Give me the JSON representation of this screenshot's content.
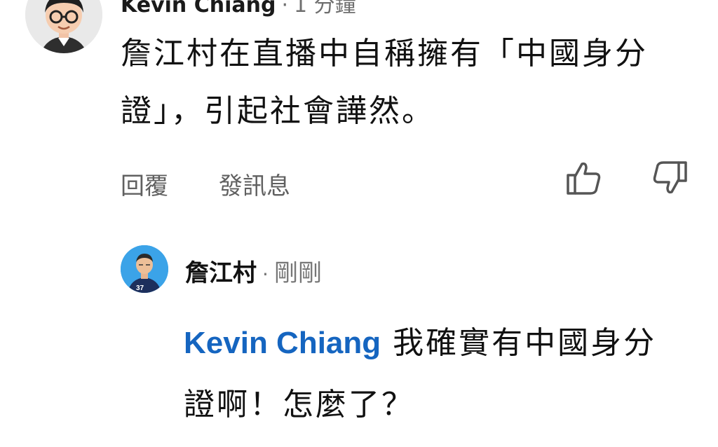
{
  "top_comment": {
    "author": "Kevin Chiang",
    "time": "1 分鐘",
    "text": "詹江村在直播中自稱擁有「中國身分證」，引起社會譁然。",
    "actions": {
      "reply_label": "回覆",
      "message_label": "發訊息"
    }
  },
  "icons": {
    "like": "thumbs-up-icon",
    "dislike": "thumbs-down-icon"
  },
  "reply": {
    "author": "詹江村",
    "separator": "·",
    "time": "剛剛",
    "mention": "Kevin Chiang",
    "text": " 我確實有中國身分證啊！怎麼了？"
  },
  "colors": {
    "mention": "#1565c0",
    "secondary_text": "#606060",
    "reply_avatar_bg": "#3ba3e8"
  }
}
